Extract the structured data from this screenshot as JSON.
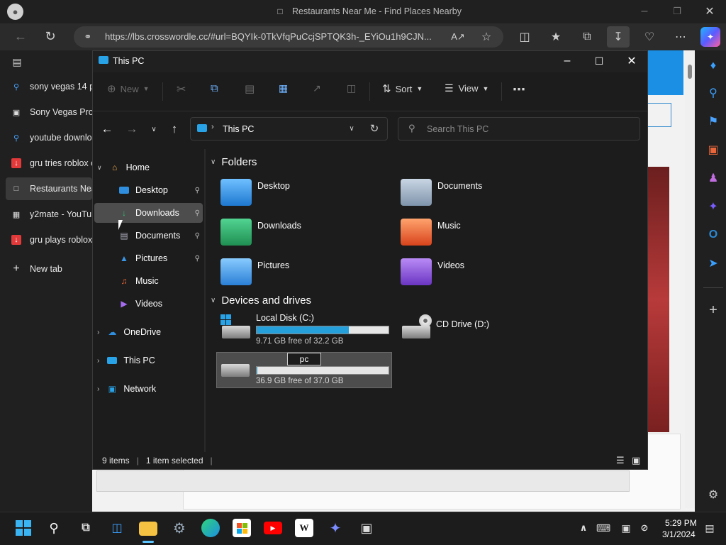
{
  "browser": {
    "title": "Restaurants Near Me - Find Places Nearby",
    "url": "https://lbs.crosswordle.cc/#url=BQYIk-0TkVfqPuCcjSPTQK3h-_EYiOu1h9CJN...",
    "tabs": [
      {
        "label": "sony vegas 14 pa",
        "icon": "search-icon"
      },
      {
        "label": "Sony Vegas Pro",
        "icon": "bank-icon"
      },
      {
        "label": "youtube downlo",
        "icon": "search-icon"
      },
      {
        "label": "gru tries roblox o",
        "icon": "download-red-icon"
      },
      {
        "label": "Restaurants Near",
        "icon": "page-icon"
      },
      {
        "label": "y2mate - YouTub",
        "icon": "y2mate-icon"
      },
      {
        "label": "gru plays roblox",
        "icon": "download-red-icon"
      }
    ],
    "new_tab_label": "New tab"
  },
  "explorer": {
    "title": "This PC",
    "toolbar": {
      "new_label": "New",
      "sort_label": "Sort",
      "view_label": "View"
    },
    "path": {
      "label": "This PC"
    },
    "search": {
      "placeholder": "Search This PC"
    },
    "nav": {
      "home": "Home",
      "quick": [
        {
          "label": "Desktop",
          "pinned": true
        },
        {
          "label": "Downloads",
          "pinned": true
        },
        {
          "label": "Documents",
          "pinned": true
        },
        {
          "label": "Pictures",
          "pinned": true
        },
        {
          "label": "Music",
          "pinned": false
        },
        {
          "label": "Videos",
          "pinned": false
        }
      ],
      "onedrive": "OneDrive",
      "thispc": "This PC",
      "network": "Network"
    },
    "folders_heading": "Folders",
    "folders": [
      {
        "label": "Desktop",
        "color": "#2f8fde"
      },
      {
        "label": "Documents",
        "color": "#8ba1b9"
      },
      {
        "label": "Downloads",
        "color": "#27a360"
      },
      {
        "label": "Music",
        "color": "#f06a38"
      },
      {
        "label": "Pictures",
        "color": "#3a95e4"
      },
      {
        "label": "Videos",
        "color": "#8a52d6"
      }
    ],
    "drives_heading": "Devices and drives",
    "drives": [
      {
        "label": "Local Disk (C:)",
        "free": "9.71 GB free of 32.2 GB",
        "used_fraction": 0.7
      },
      {
        "label": "CD Drive (D:)"
      },
      {
        "label": "pc",
        "free": "36.9 GB free of 37.0 GB",
        "used_fraction": 0.003
      }
    ],
    "status": {
      "items": "9 items",
      "selected": "1 item selected"
    }
  },
  "taskbar": {
    "time": "5:29 PM",
    "date": "3/1/2024"
  }
}
